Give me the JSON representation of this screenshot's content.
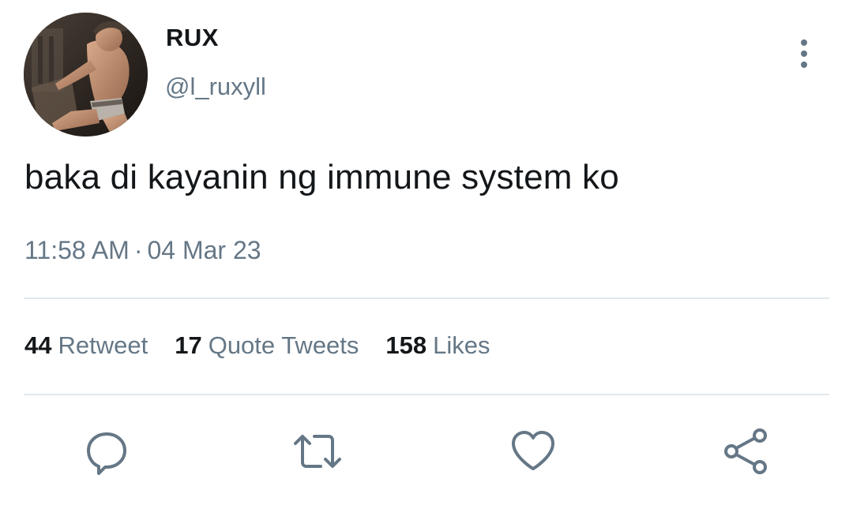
{
  "author": {
    "display_name": "RUX",
    "handle": "@l_ruxyll",
    "avatar": "profile-photo"
  },
  "tweet": {
    "text": "baka di kayanin ng immune system ko",
    "time": "11:58 AM",
    "separator": "·",
    "date": "04 Mar 23"
  },
  "stats": {
    "retweets": {
      "count": "44",
      "label": "Retweet"
    },
    "quotes": {
      "count": "17",
      "label": "Quote Tweets"
    },
    "likes": {
      "count": "158",
      "label": "Likes"
    }
  },
  "actions": {
    "reply": "reply-icon",
    "retweet": "retweet-icon",
    "like": "heart-icon",
    "share": "share-icon"
  },
  "colors": {
    "text": "#14171a",
    "secondary": "#657786",
    "divider": "#e1e8ed",
    "background": "#ffffff"
  }
}
